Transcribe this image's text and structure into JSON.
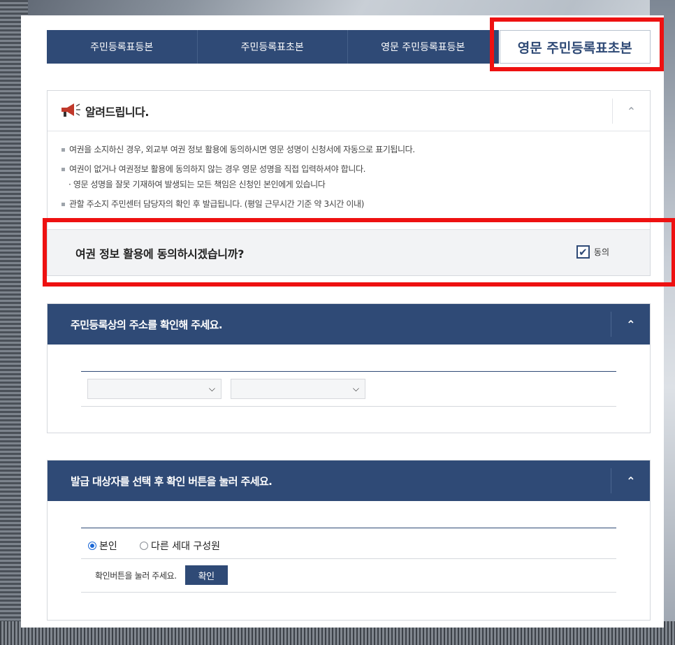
{
  "tabs": [
    {
      "label": "주민등록표등본"
    },
    {
      "label": "주민등록표초본"
    },
    {
      "label": "영문 주민등록표등본"
    },
    {
      "label": "영문 주민등록표초본"
    }
  ],
  "notice": {
    "title": "알려드립니다.",
    "lines": [
      "여권을 소지하신 경우, 외교부 여권 정보 활용에 동의하시면 영문 성명이 신청서에 자동으로 표기됩니다.",
      "여권이 없거나 여권정보 활용에 동의하지 않는 경우 영문 성명을 직접 입력하셔야 합니다.",
      "· 영문 성명을 잘못 기재하여 발생되는 모든 책임은 신청인 본인에게 있습니다",
      "관할 주소지 주민센터 담당자의 확인 후 발급됩니다. (평일 근무시간 기준 약 3시간 이내)"
    ],
    "consent_question": "여권 정보 활용에 동의하시겠습니까?",
    "consent_label": "동의",
    "consent_checked": true
  },
  "address_section": {
    "title": "주민등록상의 주소를 확인해 주세요.",
    "select1_value": "",
    "select2_value": ""
  },
  "target_section": {
    "title": "발급 대상자를 선택 후 확인 버튼을 눌러 주세요.",
    "radio_self": "본인",
    "radio_other": "다른 세대 구성원",
    "selected": "본인",
    "confirm_hint": "확인버튼을 눌러 주세요.",
    "confirm_button": "확인"
  },
  "colors": {
    "navy": "#2f4a76",
    "highlight": "#ee1111"
  }
}
